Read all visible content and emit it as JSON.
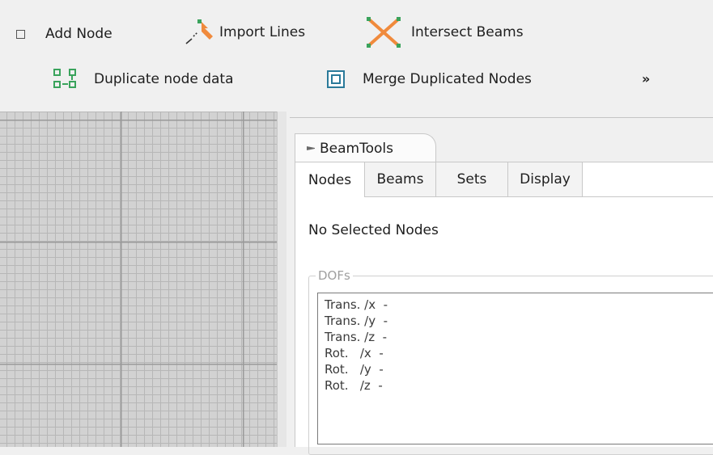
{
  "toolbar": {
    "add_node": {
      "label": "Add Node",
      "icon": "square-outline-icon"
    },
    "import_lines": {
      "label": "Import Lines",
      "icon": "import-lines-icon"
    },
    "intersect_beams": {
      "label": "Intersect Beams",
      "icon": "intersect-beams-icon"
    },
    "duplicate_node_data": {
      "label": "Duplicate node data",
      "icon": "duplicate-nodes-icon"
    },
    "merge_duplicated_nodes": {
      "label": "Merge Duplicated Nodes",
      "icon": "merge-nodes-icon"
    },
    "overflow": {
      "label": "»"
    }
  },
  "panel": {
    "title": "BeamTools",
    "tabs": [
      "Nodes",
      "Beams",
      "Sets",
      "Display"
    ],
    "active_tab": "Nodes",
    "status": "No Selected Nodes",
    "dofs": {
      "legend": "DOFs",
      "rows": [
        "Trans. /x  -",
        "Trans. /y  -",
        "Trans. /z  -",
        "Rot.   /x  -",
        "Rot.   /y  -",
        "Rot.   /z  -"
      ]
    }
  },
  "colors": {
    "accent_orange": "#f08a3c",
    "icon_green": "#3aa35c",
    "icon_teal": "#2a7a9a",
    "grid_background": "#d2d2d2"
  }
}
